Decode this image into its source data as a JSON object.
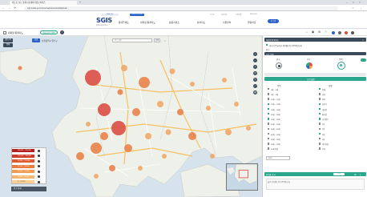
{
  "browser": {
    "tab_title": "지도로 보는 통계 | 통계지리정보서비스",
    "new_tab": "+",
    "window_controls": [
      "–",
      "□",
      "×"
    ],
    "url": "sgis.kostat.go.kr/view/map/interactiveMap/main",
    "nav_icons": [
      "←",
      "→",
      "⟳"
    ],
    "toolbar_icons": [
      "☆",
      "⋮"
    ]
  },
  "header": {
    "logo_pill": "SGIS plus",
    "logo_text": "SGIS",
    "logo_sub": "통계지리정보서비스",
    "mode_tab": "대화형 통계지도",
    "nav": [
      "통계주제도",
      "대화형 통계지도",
      "활용서비스",
      "분석지도",
      "지원센터",
      "알림마당"
    ],
    "util_links": [
      "로그인",
      "회원가입",
      "사이트맵",
      "ENGLISH"
    ],
    "login_btn": "로그인"
  },
  "toolbar": {
    "title": "대화형 통계지도",
    "pill_label": "전국 시도 단위",
    "left_btn": "경계설정",
    "right_icons": [
      "⌂",
      "▣",
      "⚙",
      "?"
    ]
  },
  "map": {
    "top_label_1": "총괄",
    "top_label_2": "인천광역시 연수구",
    "top_search": "주소 검색",
    "top_search_btn": "검색",
    "left_button": "행정구역",
    "left_button2": "범례",
    "controls": [
      "+",
      "−",
      "⌖",
      "◎",
      "✎",
      "⤢",
      "▤"
    ],
    "legend_values": [
      "188,400 ~ 256,000",
      "135,500 ~ 188,400",
      "95,300 ~ 135,500",
      "61,000 ~ 95,300",
      "35,600 ~ 61,000",
      "16,800 ~ 35,600",
      "0 ~ 16,800"
    ],
    "legend_footer": "인구 통계"
  },
  "panel": {
    "header_title": "대화형 통계지도",
    "header_close": "×",
    "line1": "총조사 주요지표 (통계청 인구주택총조사)",
    "line2": "인구",
    "section_label": "지표 선택",
    "stat_tabs": [
      "인구",
      "가구",
      "주택"
    ],
    "teal_bar": "조건 설정",
    "col_left_title": "연령",
    "col_right_title": "성별",
    "checkboxes_left": [
      "0세 ~ 4세",
      "5세 ~ 9세",
      "10세 ~ 14세",
      "15세 ~ 19세",
      "20세 ~ 24세",
      "25세 ~ 29세",
      "30세 ~ 34세",
      "35세 ~ 39세",
      "40세 ~ 44세",
      "45세 ~ 49세",
      "50세 ~ 54세",
      "55세 ~ 59세",
      "60세 이상"
    ],
    "checkboxes_right": [
      "전체",
      "남자",
      "여자",
      "총인구",
      "내국인",
      "외국인",
      "가구원수",
      "1인",
      "2인",
      "3인",
      "4인",
      "5인 이상",
      "기타"
    ],
    "checked_left": [
      3,
      4,
      5,
      6
    ],
    "checked_right": [
      0,
      3,
      4,
      5,
      6,
      9
    ],
    "select_year": "2020",
    "bottom_bar": "통계표 보기",
    "bottom_btn": "조회",
    "bottom_icons": [
      "⊞",
      "⤓"
    ],
    "footer_text": "출처: 통계청 인구주택총조사"
  },
  "colors": {
    "brand_blue": "#2b62c8",
    "teal": "#2ca58d",
    "dark_bar": "#3b4a5a",
    "bubble_dark": "#d9443b",
    "bubble_mid": "#e8824a",
    "bubble_light": "#f0a868"
  }
}
